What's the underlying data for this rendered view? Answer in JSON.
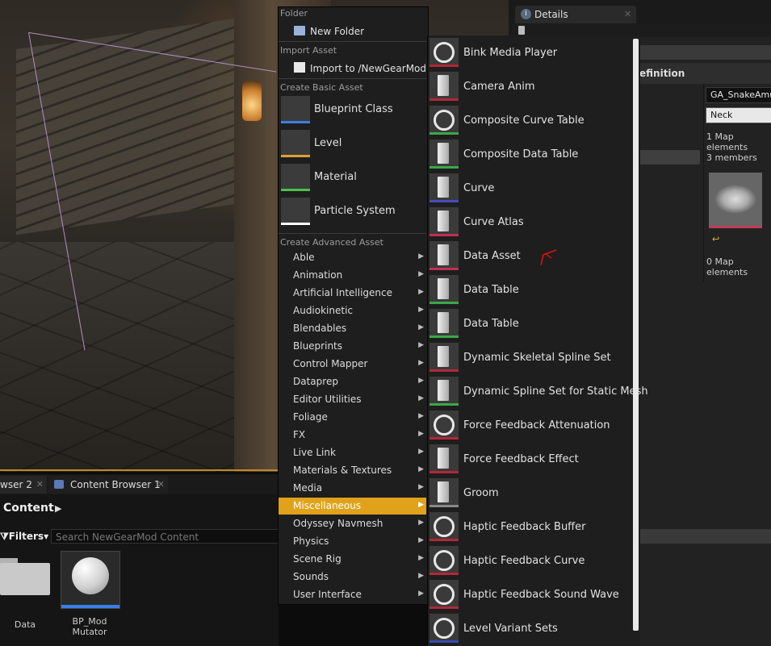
{
  "details": {
    "tab_label": "Details",
    "section_header": "efinition",
    "ability_field": "GA_SnakeAmul",
    "slot_field": "Neck",
    "map_elements_1": "1 Map elements",
    "members": "3 members",
    "map_elements_2": "0 Map elements"
  },
  "content_browser": {
    "tab_2_label": "wser 2",
    "tab_1_label": "Content Browser 1",
    "path_label": "Content",
    "filters_label": "Filters",
    "search_placeholder": "Search NewGearMod Content",
    "assets": [
      {
        "name": "Data"
      },
      {
        "name": "BP_Mod Mutator"
      }
    ]
  },
  "menu": {
    "folder_header": "Folder",
    "new_folder": "New Folder",
    "import_header": "Import Asset",
    "import_item": "Import to /NewGearMod...",
    "basic_header": "Create Basic Asset",
    "basic_items": [
      {
        "label": "Blueprint Class",
        "icon": "blueprint-class-icon",
        "color": "#3a7fe8"
      },
      {
        "label": "Level",
        "icon": "level-icon",
        "color": "#e0a030"
      },
      {
        "label": "Material",
        "icon": "material-icon",
        "color": "#4ac04a"
      },
      {
        "label": "Particle System",
        "icon": "particle-system-icon",
        "color": "#ffffff"
      }
    ],
    "advanced_header": "Create Advanced Asset",
    "advanced_items": [
      "Able",
      "Animation",
      "Artificial Intelligence",
      "Audiokinetic",
      "Blendables",
      "Blueprints",
      "Control Mapper",
      "Dataprep",
      "Editor Utilities",
      "Foliage",
      "FX",
      "Live Link",
      "Materials & Textures",
      "Media",
      "Miscellaneous",
      "Odyssey Navmesh",
      "Physics",
      "Scene Rig",
      "Sounds",
      "User Interface"
    ],
    "active_item": "Miscellaneous"
  },
  "submenu": {
    "items": [
      {
        "label": "Bink Media Player",
        "icon": "media-ring-icon",
        "color": "#b02838"
      },
      {
        "label": "Camera Anim",
        "icon": "camera-icon",
        "color": "#b02838"
      },
      {
        "label": "Composite Curve Table",
        "icon": "ring-icon",
        "color": "#3aa84a"
      },
      {
        "label": "Composite Data Table",
        "icon": "table-icon",
        "color": "#3aa84a"
      },
      {
        "label": "Curve",
        "icon": "curve-icon",
        "color": "#4a4ac0"
      },
      {
        "label": "Curve Atlas",
        "icon": "atlas-icon",
        "color": "#c03050"
      },
      {
        "label": "Data Asset",
        "icon": "data-asset-icon",
        "color": "#c03050"
      },
      {
        "label": "Data Table",
        "icon": "table-icon",
        "color": "#3aa84a"
      },
      {
        "label": "Data Table",
        "icon": "table-icon",
        "color": "#3aa84a"
      },
      {
        "label": "Dynamic Skeletal Spline Set",
        "icon": "spline-icon",
        "color": "#b02838"
      },
      {
        "label": "Dynamic Spline Set for Static Mesh",
        "icon": "spline-icon",
        "color": "#3aa84a"
      },
      {
        "label": "Force Feedback Attenuation",
        "icon": "ring-icon",
        "color": "#b02838"
      },
      {
        "label": "Force Feedback Effect",
        "icon": "gamepad-icon",
        "color": "#b02838"
      },
      {
        "label": "Groom",
        "icon": "groom-icon",
        "color": "#888888"
      },
      {
        "label": "Haptic Feedback Buffer",
        "icon": "ring-icon",
        "color": "#b02838"
      },
      {
        "label": "Haptic Feedback Curve",
        "icon": "ring-icon",
        "color": "#b02838"
      },
      {
        "label": "Haptic Feedback Sound Wave",
        "icon": "ring-icon",
        "color": "#b02838"
      },
      {
        "label": "Level Variant Sets",
        "icon": "ring-icon",
        "color": "#3a4ab0"
      }
    ]
  },
  "colors": {
    "accent": "#e0a21a",
    "annotation": "#e01010"
  }
}
